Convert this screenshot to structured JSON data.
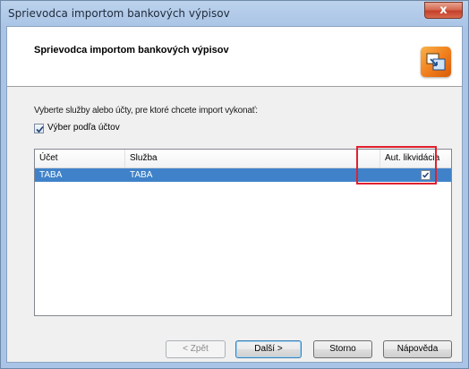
{
  "window": {
    "title": "Sprievodca importom bankových výpisov",
    "close_label": "x"
  },
  "header": {
    "title": "Sprievodca importom bankových výpisov",
    "icon": "import-wizard-icon"
  },
  "instruction": "Vyberte služby alebo účty, pre ktoré chcete import vykonať:",
  "select_by_account": {
    "label": "Výber podľa účtov",
    "checked": true
  },
  "table": {
    "columns": [
      "Účet",
      "Služba",
      "Aut. likvidácia"
    ],
    "rows": [
      {
        "account": "TABA",
        "service": "TABA",
        "auto_liquidation": true,
        "selected": true
      }
    ]
  },
  "buttons": {
    "back": "< Zpět",
    "next": "Další >",
    "cancel": "Storno",
    "help": "Nápověda"
  },
  "colors": {
    "selection": "#3f82c9",
    "highlight_box": "#e0202e",
    "accent": "#f07c1b"
  }
}
